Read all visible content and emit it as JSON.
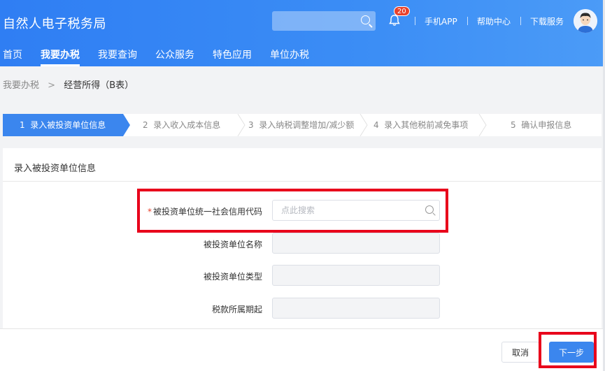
{
  "header": {
    "title": "自然人电子税务局",
    "search_placeholder": "",
    "notification_count": "20",
    "links": [
      "手机APP",
      "帮助中心",
      "下载服务"
    ]
  },
  "nav": {
    "items": [
      "首页",
      "我要办税",
      "我要查询",
      "公众服务",
      "特色应用",
      "单位办税"
    ],
    "active": "我要办税"
  },
  "breadcrumb": {
    "parent": "我要办税",
    "separator": ">",
    "current": "经营所得（B表）"
  },
  "steps": [
    {
      "num": "1",
      "label": "录入被投资单位信息"
    },
    {
      "num": "2",
      "label": "录入收入成本信息"
    },
    {
      "num": "3",
      "label": "录入纳税调整增加/减少额"
    },
    {
      "num": "4",
      "label": "录入其他税前减免事项"
    },
    {
      "num": "5",
      "label": "确认申报信息"
    }
  ],
  "form": {
    "section_title": "录入被投资单位信息",
    "credit_code": {
      "required_mark": "*",
      "label": "被投资单位统一社会信用代码",
      "placeholder": "点此搜索",
      "value": ""
    },
    "unit_name": {
      "label": "被投资单位名称",
      "value": ""
    },
    "unit_type": {
      "label": "被投资单位类型",
      "value": ""
    },
    "period_start": {
      "label": "税款所属期起",
      "value": ""
    }
  },
  "footer": {
    "cancel_label": "取消",
    "next_label": "下一步"
  },
  "colors": {
    "header_blue": "#3b8df5",
    "accent": "#3b86ee",
    "highlight_red": "#e8001b"
  }
}
